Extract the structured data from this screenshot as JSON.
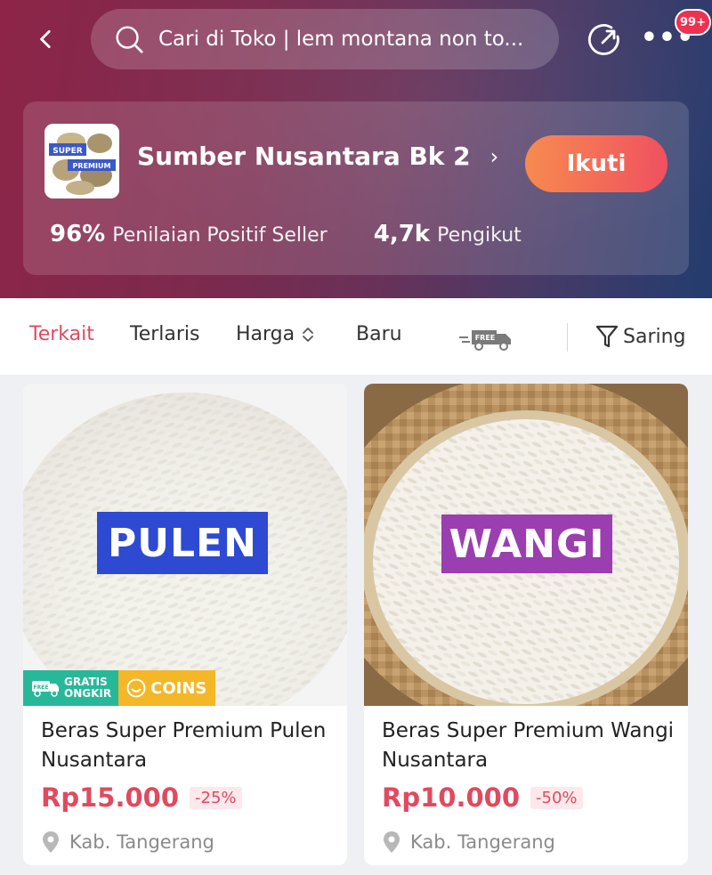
{
  "header": {
    "search_text": "Cari di Toko |  lem montana non to...",
    "notification_badge": "99+"
  },
  "store": {
    "name": "Sumber Nusantara Bk 2",
    "logo_text_top": "SUPER",
    "logo_text_bottom": "PREMIUM",
    "follow_label": "Ikuti",
    "rating_value": "96%",
    "rating_label": "Penilaian Positif Seller",
    "followers_value": "4,7k",
    "followers_label": "Pengikut"
  },
  "filters": {
    "items": [
      {
        "label": "Terkait",
        "active": true
      },
      {
        "label": "Terlaris",
        "active": false
      },
      {
        "label": "Harga",
        "active": false
      },
      {
        "label": "Baru",
        "active": false
      }
    ],
    "free_icon_text": "FREE",
    "saring_label": "Saring"
  },
  "products": [
    {
      "image_label": "PULEN",
      "tag_ongkir_line1": "GRATIS",
      "tag_ongkir_line2": "ONGKIR",
      "tag_ongkir_icon_text": "FREE",
      "tag_coins": "COINS",
      "title": "Beras Super Premium Pulen Nusantara",
      "price": "Rp15.000",
      "discount": "-25%",
      "location": "Kab. Tangerang"
    },
    {
      "image_label": "WANGI",
      "title": "Beras Super Premium Wangi Nusantara",
      "price": "Rp10.000",
      "discount": "-50%",
      "location": "Kab. Tangerang"
    }
  ],
  "colors": {
    "accent_red": "#e04a5f",
    "follow_gradient_start": "#f7874a",
    "follow_gradient_end": "#f04e5e",
    "pulen_label_bg": "#2e4ad3",
    "wangi_label_bg": "#9b3eb0",
    "ongkir_tag": "#27b89a",
    "coins_tag": "#f4b728"
  }
}
